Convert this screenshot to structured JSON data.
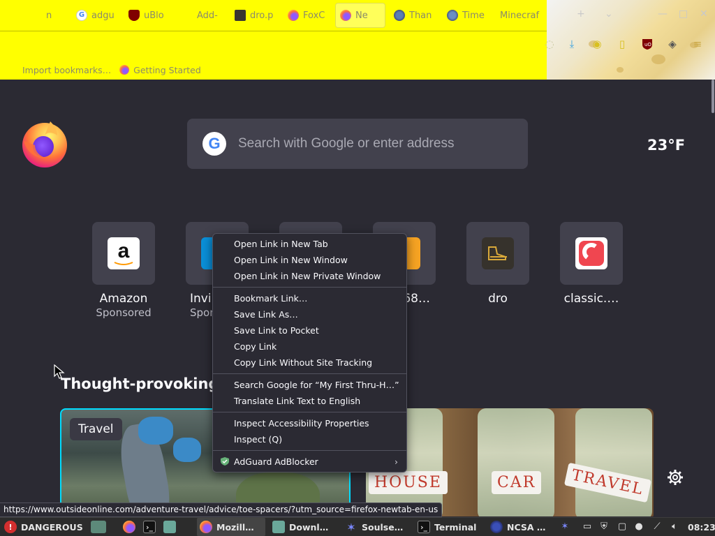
{
  "browser": {
    "tabs": [
      {
        "label": "n",
        "icon": "tab-icon"
      },
      {
        "label": "adgu",
        "icon": "google-icon"
      },
      {
        "label": "uBlo",
        "icon": "ublock-icon"
      },
      {
        "label": "Add-",
        "icon": "addons-icon"
      },
      {
        "label": "dro.p",
        "icon": "dro-icon"
      },
      {
        "label": "FoxC",
        "icon": "firefox-icon"
      },
      {
        "label": "Ne",
        "icon": "firefox-icon"
      },
      {
        "label": "Than",
        "icon": "globe-icon"
      },
      {
        "label": "Time",
        "icon": "globe-icon"
      },
      {
        "label": "Minecraf",
        "icon": "none"
      }
    ],
    "window_controls": {
      "new_tab": "+",
      "list_tabs": "⌄",
      "minimize": "—",
      "maximize": "□",
      "close": "✕"
    },
    "bookmarks": [
      {
        "label": "Import bookmarks…"
      },
      {
        "label": "Getting Started"
      }
    ],
    "colors": {
      "theme_yellow": "#ffff00",
      "bg": "#2b2a33",
      "focus_accent": "#00ddff"
    }
  },
  "newtab": {
    "search_placeholder": "Search with Google or enter address",
    "google_letter": "G",
    "weather": "23°F",
    "top_sites": [
      {
        "label": "Amazon",
        "sub": "Sponsored",
        "icon": "amazon-icon"
      },
      {
        "label": "Invi",
        "sub": "Spon",
        "icon": "booking-icon"
      },
      {
        "label": "",
        "sub": "",
        "icon": "site-icon"
      },
      {
        "label": "68…",
        "sub": "",
        "icon": "orange-site-icon"
      },
      {
        "label": "dro",
        "sub": "",
        "icon": "dro-shoe-icon"
      },
      {
        "label": "classic.…",
        "sub": "",
        "icon": "classic-icon"
      }
    ],
    "section_title": "Thought-provoking",
    "card1_badge": "Travel",
    "card2_jar_labels": [
      "HOUSE",
      "CAR",
      "TRAVEL"
    ]
  },
  "context_menu": {
    "groups": [
      [
        "Open Link in New Tab",
        "Open Link in New Window",
        "Open Link in New Private Window"
      ],
      [
        "Bookmark Link…",
        "Save Link As…",
        "Save Link to Pocket",
        "Copy Link",
        "Copy Link Without Site Tracking"
      ],
      [
        "Search Google for “My First Thru-H…”",
        "Translate Link Text to English"
      ],
      [
        "Inspect Accessibility Properties",
        "Inspect (Q)"
      ],
      [
        "AdGuard AdBlocker"
      ]
    ]
  },
  "status_url": "https://www.outsideonline.com/adventure-travel/advice/toe-spacers/?utm_source=firefox-newtab-en-us",
  "taskbar": {
    "warning": "DANGEROUS",
    "tasks": [
      {
        "label": "Mozill…",
        "icon": "firefox-icon"
      },
      {
        "label": "Downl…",
        "icon": "folder-icon"
      },
      {
        "label": "Soulse…",
        "icon": "soulseek-icon"
      },
      {
        "label": "Terminal",
        "icon": "terminal-icon"
      },
      {
        "label": "NCSA …",
        "icon": "ncsa-icon"
      }
    ],
    "clock": "08:23"
  }
}
